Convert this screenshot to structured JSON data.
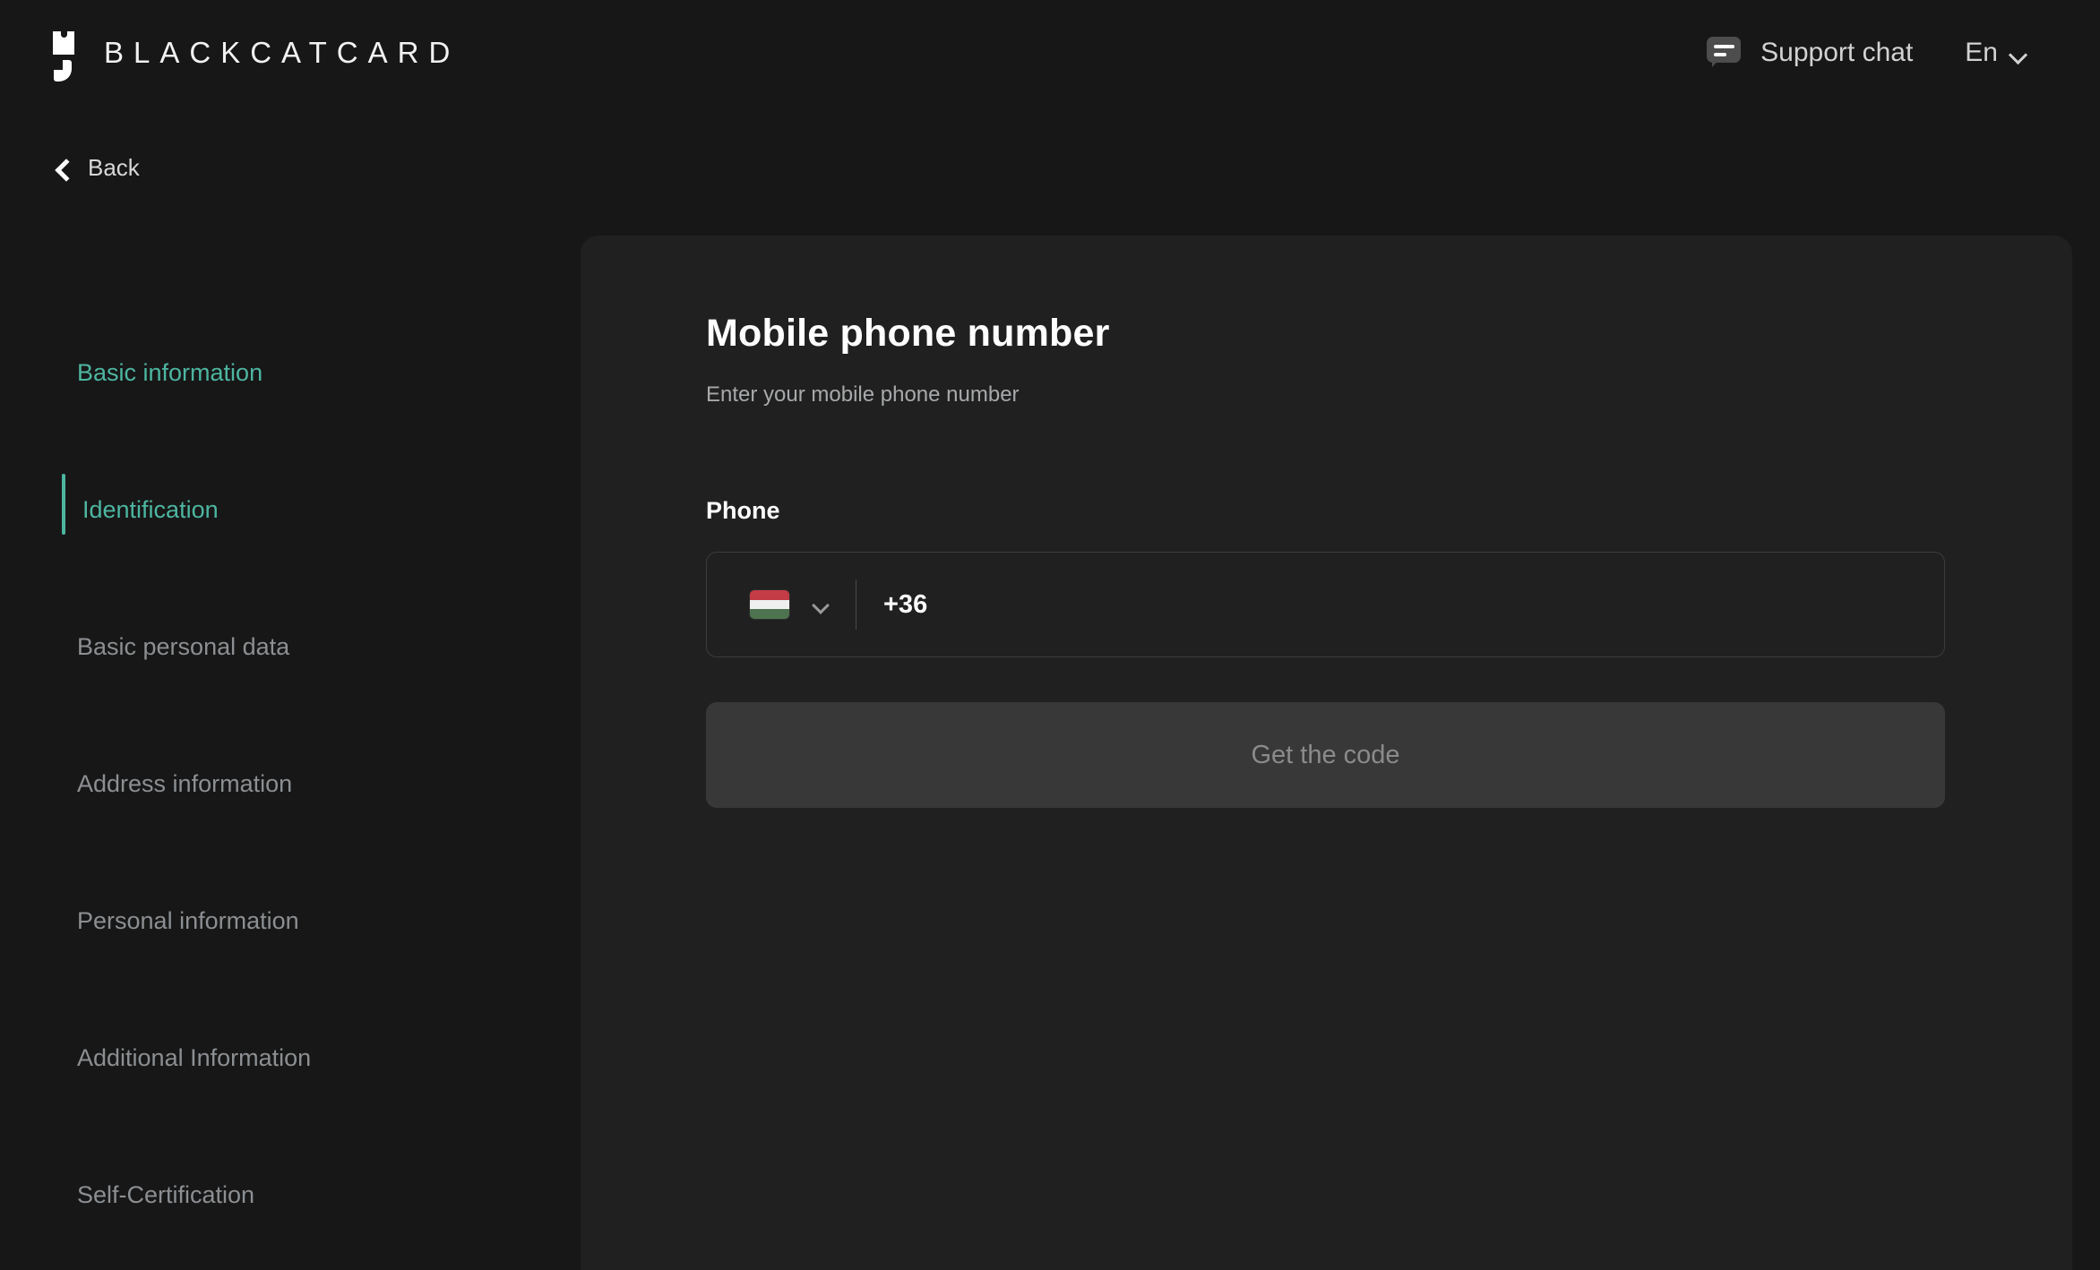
{
  "header": {
    "brand_name": "BLACKCATCARD",
    "brand_icon": "blackcat-logo-icon",
    "support_chat_label": "Support chat",
    "support_chat_icon": "chat-bubble-icon",
    "language_label": "En",
    "language_chevron_icon": "chevron-down-icon"
  },
  "back": {
    "label": "Back",
    "icon": "chevron-left-icon"
  },
  "sidebar": {
    "items": [
      {
        "label": "Basic information",
        "state": "done"
      },
      {
        "label": "Identification",
        "state": "active"
      },
      {
        "label": "Basic personal data",
        "state": "pending"
      },
      {
        "label": "Address information",
        "state": "pending"
      },
      {
        "label": "Personal information",
        "state": "pending"
      },
      {
        "label": "Additional Information",
        "state": "pending"
      },
      {
        "label": "Self-Certification",
        "state": "pending"
      }
    ]
  },
  "main": {
    "title": "Mobile phone number",
    "subtitle": "Enter your mobile phone number",
    "field_label": "Phone",
    "country": {
      "flag": "hungary-flag-icon",
      "chevron_icon": "chevron-down-icon",
      "dial_code": "+36"
    },
    "phone_value": "",
    "phone_placeholder": "",
    "submit_label": "Get the code",
    "submit_disabled": true
  },
  "colors": {
    "page_background": "#171717",
    "card_background": "#202020",
    "accent_teal": "#4db6a0",
    "muted_text": "#8c8f92",
    "disabled_button": "#383838",
    "flag_red": "#c43c46",
    "flag_white": "#efefef",
    "flag_green": "#4e7350"
  }
}
